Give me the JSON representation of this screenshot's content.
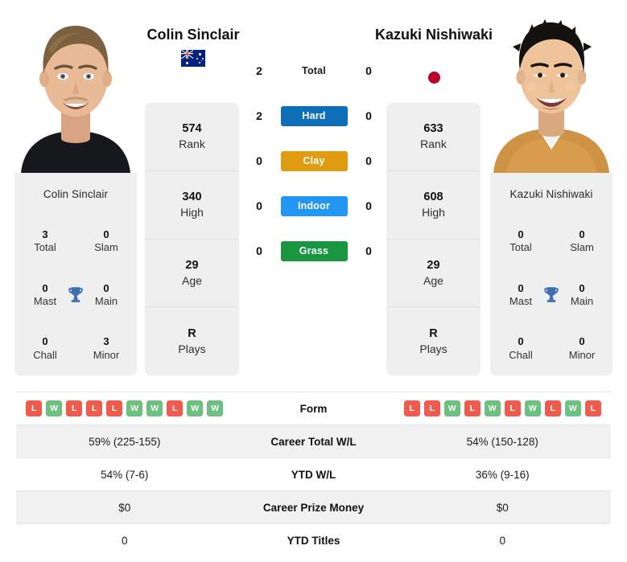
{
  "players": {
    "left": {
      "name": "Colin Sinclair",
      "photo_caption": "Colin Sinclair",
      "flag": "australia-flag-icon",
      "stats": [
        {
          "num": "574",
          "label": "Rank"
        },
        {
          "num": "340",
          "label": "High"
        },
        {
          "num": "29",
          "label": "Age"
        },
        {
          "num": "R",
          "label": "Plays"
        }
      ],
      "titles": [
        {
          "num": "3",
          "label": "Total"
        },
        {
          "num": "0",
          "label": "Slam"
        },
        {
          "num": "0",
          "label": "Mast"
        },
        {
          "num": "0",
          "label": "Main"
        },
        {
          "num": "0",
          "label": "Chall"
        },
        {
          "num": "3",
          "label": "Minor"
        }
      ],
      "form": [
        "L",
        "W",
        "L",
        "L",
        "L",
        "W",
        "W",
        "L",
        "W",
        "W"
      ],
      "career_total_wl": "59% (225-155)",
      "ytd_wl": "54% (7-6)",
      "career_prize_money": "$0",
      "ytd_titles": "0"
    },
    "right": {
      "name": "Kazuki Nishiwaki",
      "photo_caption": "Kazuki Nishiwaki",
      "flag": "japan-flag-icon",
      "stats": [
        {
          "num": "633",
          "label": "Rank"
        },
        {
          "num": "608",
          "label": "High"
        },
        {
          "num": "29",
          "label": "Age"
        },
        {
          "num": "R",
          "label": "Plays"
        }
      ],
      "titles": [
        {
          "num": "0",
          "label": "Total"
        },
        {
          "num": "0",
          "label": "Slam"
        },
        {
          "num": "0",
          "label": "Mast"
        },
        {
          "num": "0",
          "label": "Main"
        },
        {
          "num": "0",
          "label": "Chall"
        },
        {
          "num": "0",
          "label": "Minor"
        }
      ],
      "form": [
        "L",
        "L",
        "W",
        "L",
        "W",
        "L",
        "W",
        "L",
        "W",
        "L"
      ],
      "career_total_wl": "54% (150-128)",
      "ytd_wl": "36% (9-16)",
      "career_prize_money": "$0",
      "ytd_titles": "0"
    }
  },
  "head_to_head": [
    {
      "label": "Total",
      "left": "2",
      "right": "0",
      "color": "none",
      "style": "plain"
    },
    {
      "label": "Hard",
      "left": "2",
      "right": "0",
      "color": "#0e6eb8",
      "style": "pill"
    },
    {
      "label": "Clay",
      "left": "0",
      "right": "0",
      "color": "#e09c10",
      "style": "pill"
    },
    {
      "label": "Indoor",
      "left": "0",
      "right": "0",
      "color": "#2196f3",
      "style": "pill"
    },
    {
      "label": "Grass",
      "left": "0",
      "right": "0",
      "color": "#1a9641",
      "style": "pill"
    }
  ],
  "comparison_rows": [
    {
      "label": "Form",
      "left": "",
      "right": "",
      "type": "form"
    },
    {
      "label": "Career Total W/L",
      "left": "59% (225-155)",
      "right": "54% (150-128)",
      "type": "text"
    },
    {
      "label": "YTD W/L",
      "left": "54% (7-6)",
      "right": "36% (9-16)",
      "type": "text"
    },
    {
      "label": "Career Prize Money",
      "left": "$0",
      "right": "$0",
      "type": "text"
    },
    {
      "label": "YTD Titles",
      "left": "0",
      "right": "0",
      "type": "text"
    }
  ],
  "colors": {
    "hard": "#0e6eb8",
    "clay": "#e09c10",
    "indoor": "#2196f3",
    "grass": "#1a9641",
    "win_badge": "#6cc080",
    "loss_badge": "#ef5b4c",
    "trophy": "#3d6fb0",
    "panel_bg": "#efefef"
  },
  "icons": {
    "trophy": "trophy-icon"
  }
}
